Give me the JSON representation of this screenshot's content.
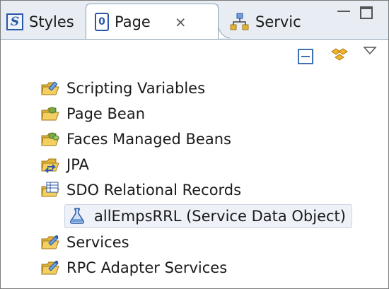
{
  "tabs": [
    {
      "label": "Styles",
      "icon": "styles-icon"
    },
    {
      "label": "Page",
      "icon": "page-icon",
      "active": true
    },
    {
      "label": "Servic",
      "icon": "services-tab-icon"
    }
  ],
  "tree": {
    "items": [
      {
        "label": "Scripting Variables",
        "icon": "scripting-variables-icon"
      },
      {
        "label": "Page Bean",
        "icon": "page-bean-icon"
      },
      {
        "label": "Faces Managed Beans",
        "icon": "managed-beans-icon"
      },
      {
        "label": "JPA",
        "icon": "jpa-icon"
      },
      {
        "label": "SDO Relational Records",
        "icon": "sdo-records-icon"
      },
      {
        "label": "allEmpsRRL (Service Data Object)",
        "icon": "data-object-icon",
        "selected": true
      },
      {
        "label": "Services",
        "icon": "services-icon"
      },
      {
        "label": "RPC Adapter Services",
        "icon": "rpc-adapter-icon"
      }
    ]
  },
  "colors": {
    "accent": "#2b57a8",
    "folder": "#e0b23a",
    "tab_bg": "#e8edf3"
  }
}
